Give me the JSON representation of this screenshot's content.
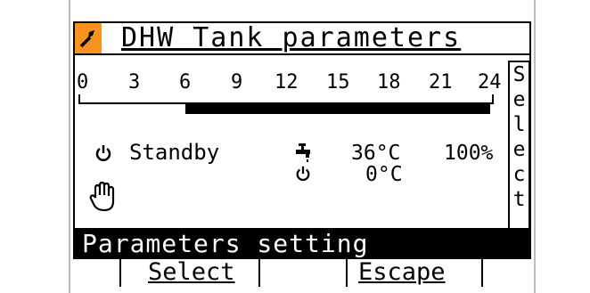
{
  "header": {
    "title": "DHW Tank parameters",
    "icon": "wrench-icon",
    "icon_color": "#f7931e"
  },
  "scale": {
    "ticks": [
      "0",
      "3",
      "6",
      "9",
      "12",
      "15",
      "18",
      "21",
      "24"
    ],
    "active_from_hour": 6,
    "active_to_hour": 24
  },
  "side_button": {
    "letters": [
      "S",
      "e",
      "l",
      "e",
      "c",
      "t"
    ]
  },
  "status": {
    "mode_icon": "power-icon",
    "mode_label": "Standby",
    "manual_icon": "hand-icon"
  },
  "readings": {
    "tap_icon": "tap-icon",
    "temperature": "36°C",
    "power_icon": "power-icon",
    "setpoint": "0°C",
    "percent": "100%"
  },
  "status_bar": {
    "text": "Parameters setting"
  },
  "softkeys": {
    "key2": "Select",
    "key4": "Escape"
  }
}
